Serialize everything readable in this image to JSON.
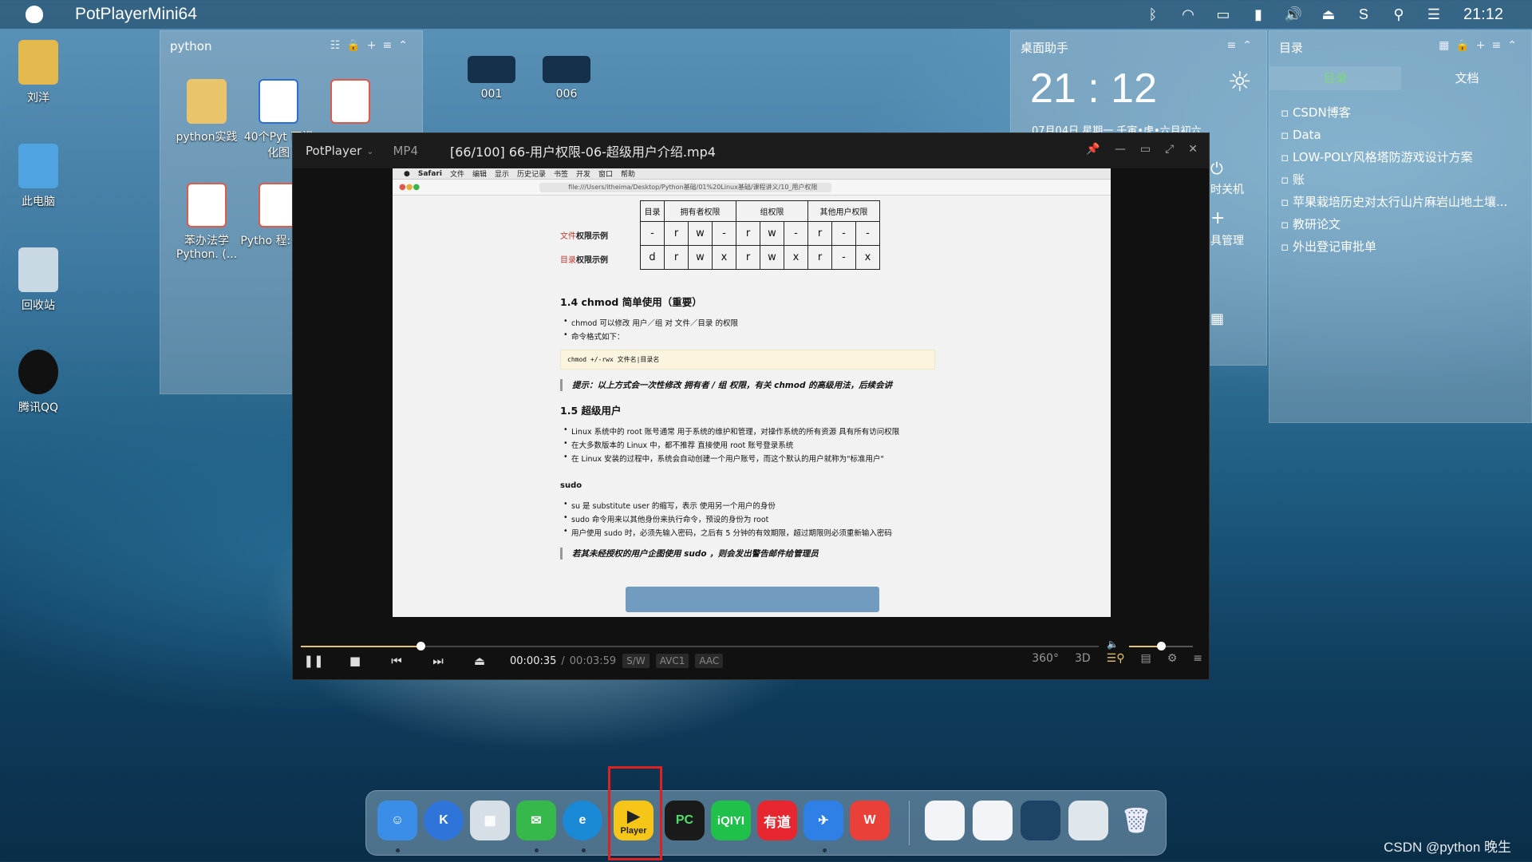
{
  "menubar": {
    "app_name": "PotPlayerMini64",
    "time": "21:12"
  },
  "desktop_icons": [
    "刘洋",
    "此电脑",
    "回收站",
    "腾讯QQ"
  ],
  "python_widget": {
    "title": "python",
    "items": [
      "python实践",
      "40个Pyt 可视化图",
      "PDF",
      "苯办法学 Python. (...",
      "Pytho 程: 从入"
    ]
  },
  "thumbs": [
    "001",
    "006"
  ],
  "assistant": {
    "title": "桌面助手",
    "time": "21 : 12",
    "date": "07月04日  星期一  壬寅•虎•六月初六",
    "shutdown": "时关机",
    "tools": "具管理"
  },
  "catalog": {
    "title": "目录",
    "tabs": [
      "目录",
      "文档"
    ],
    "items": [
      "CSDN博客",
      "Data",
      "LOW-POLY风格塔防游戏设计方案",
      "账",
      "苹果栽培历史对太行山片麻岩山地土壤...",
      "教研论文",
      "外出登记审批单"
    ]
  },
  "player": {
    "brand": "PotPlayer",
    "format": "MP4",
    "file": "[66/100] 66-用户权限-06-超级用户介绍.mp4",
    "time_current": "00:00:35",
    "time_total": "00:03:59",
    "tags": [
      "S/W",
      "AVC1",
      "AAC"
    ],
    "progress": 0.15,
    "volume": 0.5
  },
  "safari": {
    "menu": [
      "Safari",
      "文件",
      "编辑",
      "显示",
      "历史记录",
      "书签",
      "开发",
      "窗口",
      "帮助"
    ],
    "url": "file:///Users/itheima/Desktop/Python基础/01%20Linux基础/课程讲义/10_用户权限",
    "table_head": [
      "目录",
      "拥有者权限",
      "组权限",
      "其他用户权限"
    ],
    "row1_label": "文件",
    "row1_suffix": "权限示例",
    "row1": [
      "-",
      "r",
      "w",
      "-",
      "r",
      "w",
      "-",
      "r",
      "-",
      "-"
    ],
    "row2_label": "目录",
    "row2_suffix": "权限示例",
    "row2": [
      "d",
      "r",
      "w",
      "x",
      "r",
      "w",
      "x",
      "r",
      "-",
      "x"
    ],
    "h14": "1.4 chmod 简单使用（重要）",
    "l1": "chmod 可以修改 用户／组 对 文件／目录 的权限",
    "l2": "命令格式如下：",
    "code": "chmod +/-rwx 文件名|目录名",
    "tip1": "提示：以上方式会一次性修改 拥有者 / 组 权限，有关 chmod 的高级用法，后续会讲",
    "h15": "1.5 超级用户",
    "s1": "Linux 系统中的 root 账号通常 用于系统的维护和管理，对操作系统的所有资源 具有所有访问权限",
    "s2": "在大多数版本的 Linux 中，都不推荐 直接使用 root 账号登录系统",
    "s3": "在 Linux 安装的过程中，系统会自动创建一个用户账号，而这个默认的用户就称为\"标准用户\"",
    "sudo": "sudo",
    "u1": "su 是 substitute user 的缩写，表示 使用另一个用户的身份",
    "u2": "sudo 命令用来以其他身份来执行命令，预设的身份为 root",
    "u3": "用户使用 sudo 时，必须先输入密码，之后有 5 分钟的有效期限，超过期限则必须重新输入密码",
    "tip2": "若其未经授权的用户企图使用 sudo ，则会发出警告邮件给管理员"
  },
  "dock": {
    "player_label": "Player",
    "iqiyi": "iQIYI",
    "youdao": "有道",
    "pc": "PC"
  },
  "watermark": "CSDN @python 晚生"
}
